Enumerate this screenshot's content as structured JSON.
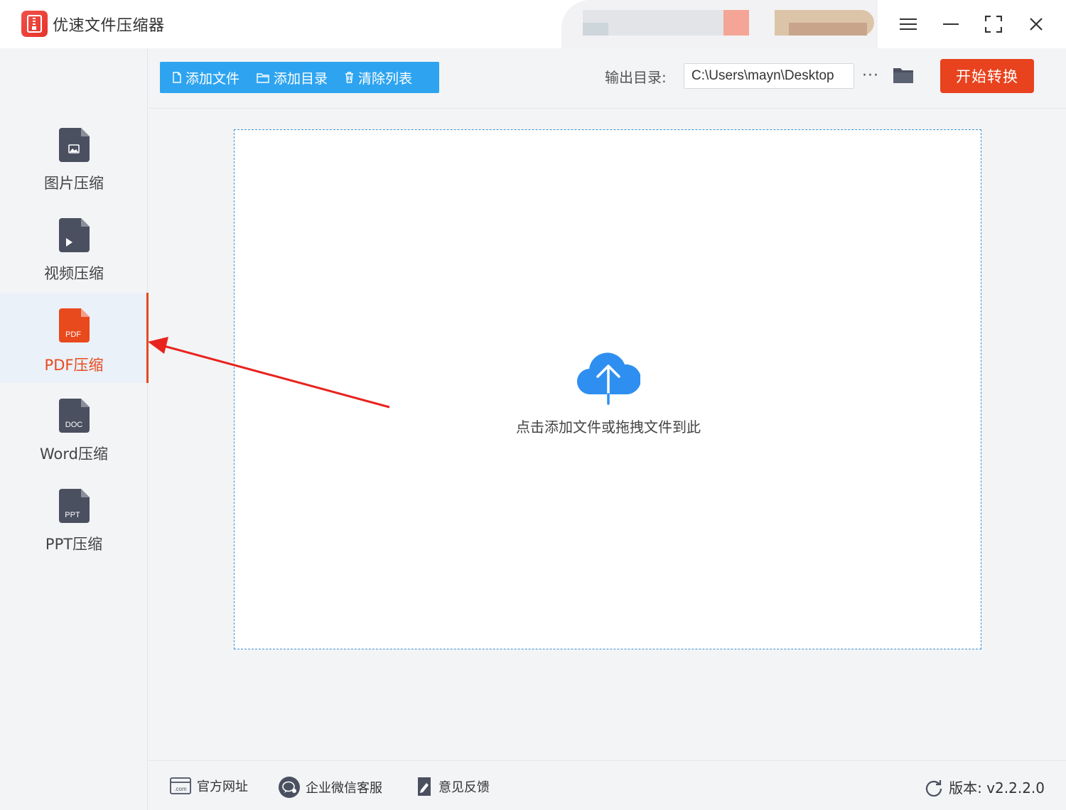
{
  "app": {
    "title": "优速文件压缩器"
  },
  "sidebar": {
    "items": [
      {
        "label": "图片压缩",
        "icon": "image-file-icon",
        "badge": ""
      },
      {
        "label": "视频压缩",
        "icon": "video-file-icon",
        "badge": ""
      },
      {
        "label": "PDF压缩",
        "icon": "pdf-file-icon",
        "badge": "PDF",
        "active": true
      },
      {
        "label": "Word压缩",
        "icon": "doc-file-icon",
        "badge": "DOC"
      },
      {
        "label": "PPT压缩",
        "icon": "ppt-file-icon",
        "badge": "PPT"
      }
    ]
  },
  "toolbar": {
    "add_file": "添加文件",
    "add_dir": "添加目录",
    "clear_list": "清除列表",
    "output_label": "输出目录:",
    "output_path": "C:\\Users\\mayn\\Desktop",
    "more": "···",
    "start": "开始转换"
  },
  "main": {
    "drop_hint": "点击添加文件或拖拽文件到此"
  },
  "footer": {
    "website": "官方网址",
    "wechat": "企业微信客服",
    "feedback": "意见反馈",
    "version": "版本: v2.2.2.0"
  },
  "colors": {
    "accent": "#e8491d",
    "primary": "#2ea4f0",
    "icon_dark": "#4a5060"
  }
}
